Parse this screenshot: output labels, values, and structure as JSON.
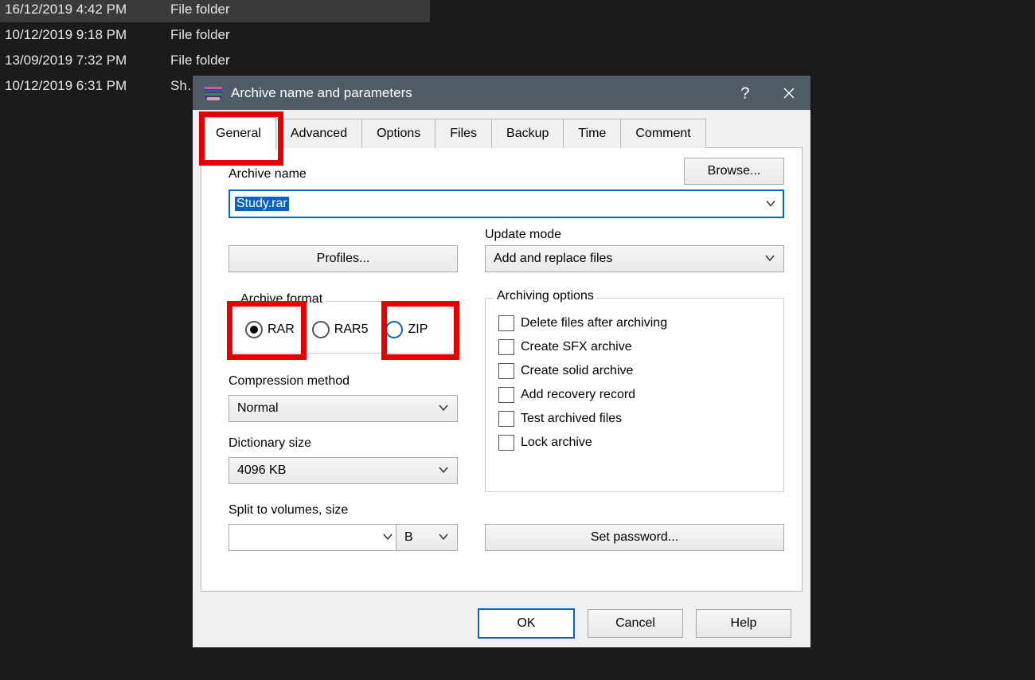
{
  "explorer": {
    "rows": [
      {
        "date": "16/12/2019 4:42 PM",
        "type": "File folder",
        "selected": true
      },
      {
        "date": "10/12/2019 9:18 PM",
        "type": "File folder",
        "selected": false
      },
      {
        "date": "13/09/2019 7:32 PM",
        "type": "File folder",
        "selected": false
      },
      {
        "date": "10/12/2019 6:31 PM",
        "type": "Sh…",
        "selected": false
      }
    ]
  },
  "dialog": {
    "title": "Archive name and parameters",
    "tabs": [
      "General",
      "Advanced",
      "Options",
      "Files",
      "Backup",
      "Time",
      "Comment"
    ],
    "active_tab": 0,
    "archive_name_label": "Archive name",
    "archive_name_value": "Study.rar",
    "browse_label": "Browse...",
    "profiles_label": "Profiles...",
    "update_mode_label": "Update mode",
    "update_mode_value": "Add and replace files",
    "format": {
      "legend": "Archive format",
      "options": [
        "RAR",
        "RAR5",
        "ZIP"
      ],
      "selected": "RAR"
    },
    "compression_label": "Compression method",
    "compression_value": "Normal",
    "dictionary_label": "Dictionary size",
    "dictionary_value": "4096 KB",
    "split_label": "Split to volumes, size",
    "split_value": "",
    "split_unit": "B",
    "archiving_options": {
      "legend": "Archiving options",
      "items": [
        "Delete files after archiving",
        "Create SFX archive",
        "Create solid archive",
        "Add recovery record",
        "Test archived files",
        "Lock archive"
      ]
    },
    "set_password_label": "Set password...",
    "buttons": {
      "ok": "OK",
      "cancel": "Cancel",
      "help": "Help"
    }
  }
}
